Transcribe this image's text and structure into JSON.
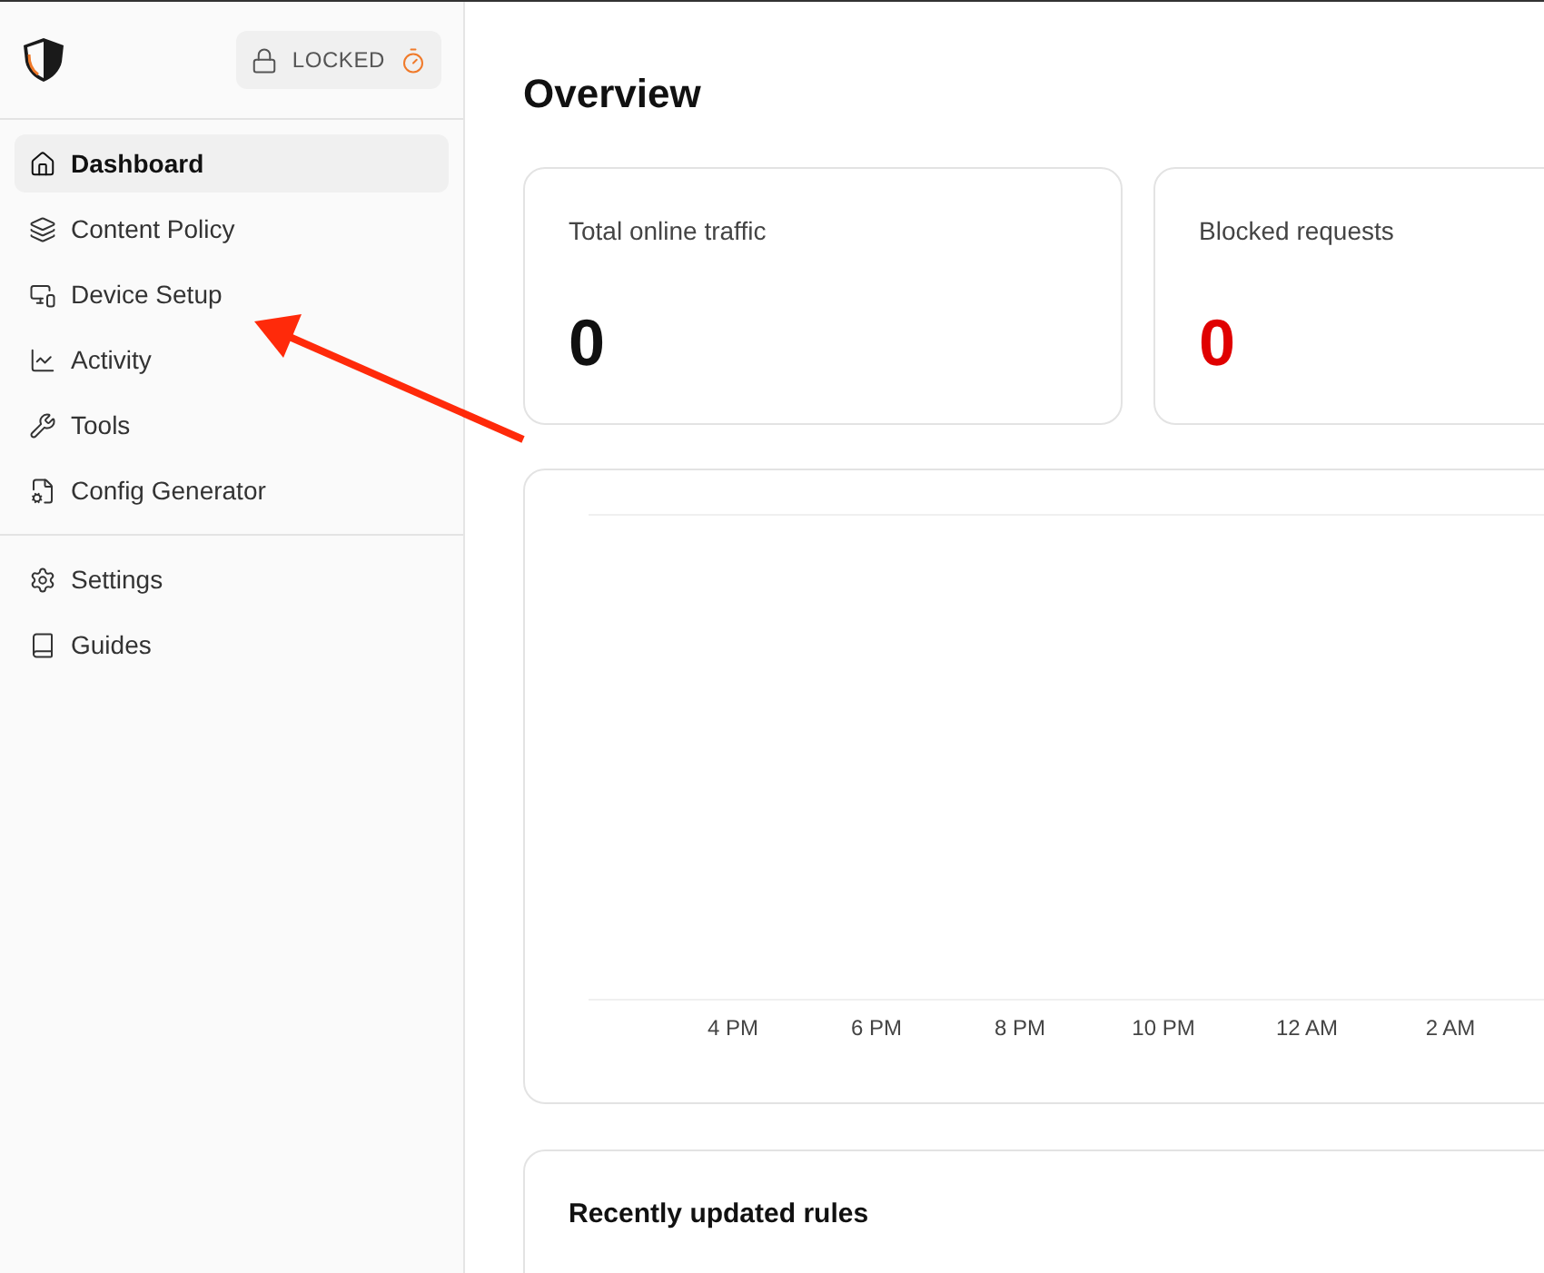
{
  "sidebar": {
    "lock": {
      "label": "LOCKED"
    },
    "items": [
      {
        "label": "Dashboard",
        "kind": "home",
        "selected": true
      },
      {
        "label": "Content Policy",
        "kind": "layers",
        "selected": false
      },
      {
        "label": "Device Setup",
        "kind": "devices",
        "selected": false
      },
      {
        "label": "Activity",
        "kind": "chart",
        "selected": false
      },
      {
        "label": "Tools",
        "kind": "wrench",
        "selected": false
      },
      {
        "label": "Config Generator",
        "kind": "filecog",
        "selected": false
      }
    ],
    "footer_items": [
      {
        "label": "Settings",
        "kind": "settings",
        "selected": false
      },
      {
        "label": "Guides",
        "kind": "book",
        "selected": false
      }
    ]
  },
  "main": {
    "title": "Overview",
    "stats": [
      {
        "label": "Total online traffic",
        "value": "0",
        "kind": "neutral"
      },
      {
        "label": "Blocked requests",
        "value": "0",
        "kind": "alert"
      }
    ],
    "chart": {
      "x_labels": [
        "4 PM",
        "6 PM",
        "8 PM",
        "10 PM",
        "12 AM",
        "2 AM"
      ]
    },
    "recent": {
      "title": "Recently updated rules"
    }
  }
}
